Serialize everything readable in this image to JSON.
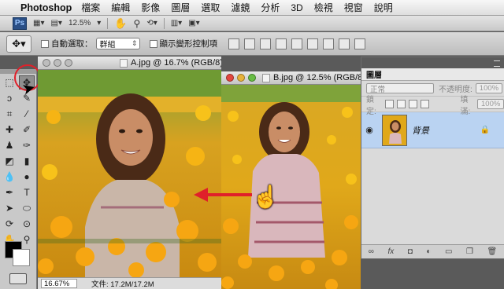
{
  "menubar": {
    "app_name": "Photoshop",
    "items": [
      "檔案",
      "編輯",
      "影像",
      "圖層",
      "選取",
      "濾鏡",
      "分析",
      "3D",
      "檢視",
      "視窗",
      "說明"
    ]
  },
  "appbar": {
    "ps_label": "Ps",
    "zoom_value": "12.5%"
  },
  "options": {
    "auto_select_label": "自動選取：",
    "auto_select_value": "群組",
    "show_transform_label": "顯示變形控制項"
  },
  "doc_a": {
    "title": "A.jpg @ 16.7% (RGB/8)",
    "zoom": "16.67%",
    "doc_info": "文件: 17.2M/17.2M"
  },
  "doc_b": {
    "title": "B.jpg @ 12.5% (RGB/8"
  },
  "layers_panel": {
    "tab_label": "圖層",
    "blend_mode": "正常",
    "opacity_label": "不透明度:",
    "opacity_value": "100%",
    "lock_label": "鎖定:",
    "fill_label": "填滿:",
    "fill_value": "100%",
    "layer_name": "背景"
  },
  "colors": {
    "drag_arrow": "#e0202a",
    "selected_layer": "#bad3f2",
    "flower_yellow": "#f6b414"
  }
}
